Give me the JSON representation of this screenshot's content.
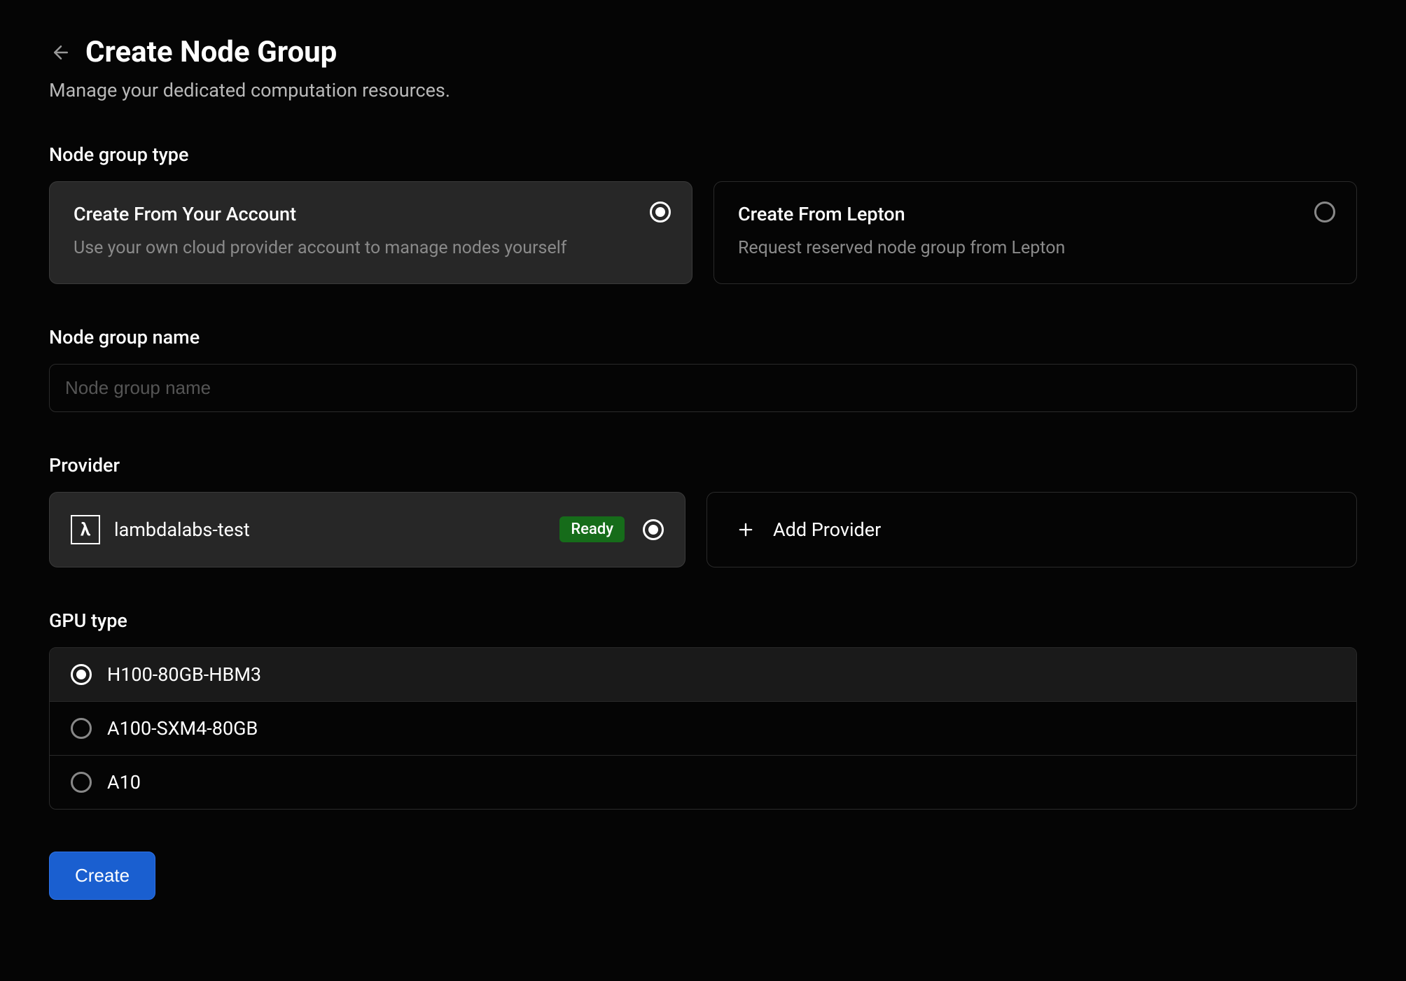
{
  "header": {
    "title": "Create Node Group",
    "subtitle": "Manage your dedicated computation resources."
  },
  "sections": {
    "type_label": "Node group type",
    "name_label": "Node group name",
    "provider_label": "Provider",
    "gpu_label": "GPU type"
  },
  "type_options": [
    {
      "title": "Create From Your Account",
      "desc": "Use your own cloud provider account to manage nodes yourself",
      "selected": true
    },
    {
      "title": "Create From Lepton",
      "desc": "Request reserved node group from Lepton",
      "selected": false
    }
  ],
  "name_input": {
    "placeholder": "Node group name",
    "value": ""
  },
  "providers": [
    {
      "logo_glyph": "λ",
      "name": "lambdalabs-test",
      "status": "Ready",
      "selected": true
    }
  ],
  "add_provider_label": "Add Provider",
  "gpu_types": [
    {
      "name": "H100-80GB-HBM3",
      "selected": true
    },
    {
      "name": "A100-SXM4-80GB",
      "selected": false
    },
    {
      "name": "A10",
      "selected": false
    }
  ],
  "actions": {
    "create": "Create"
  }
}
